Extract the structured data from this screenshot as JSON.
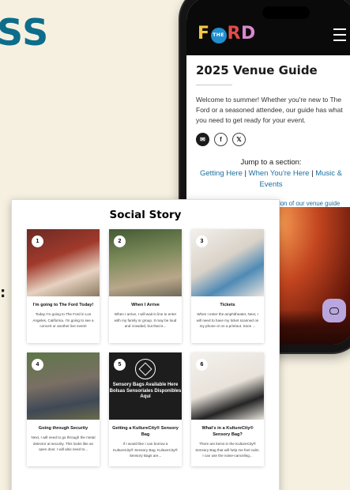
{
  "background": {
    "letters": "SS",
    "colon": ":"
  },
  "phone": {
    "logo": {
      "f": "F",
      "the": "THE",
      "r": "R",
      "d": "D"
    },
    "venue_title": "2025 Venue Guide",
    "welcome": "Welcome to summer! Whether you're new to The Ford or a seasoned attendee, our guide has what you need to get ready for your event.",
    "jump_label": "Jump to a section:",
    "jump_links": [
      "Getting Here",
      "When You're Here",
      "Music & Events"
    ],
    "separator": "|",
    "sensory_link": "View a sensory-friendly version of our venue guide",
    "share_icons": [
      "✉",
      "f",
      "𝕏"
    ]
  },
  "story": {
    "title": "Social Story",
    "tiles": [
      {
        "num": "1",
        "title": "I'm going to The Ford Today!",
        "desc": "Today I'm going to The Ford in Los Angeles, California. I'm going to see a concert or another live event!"
      },
      {
        "num": "2",
        "title": "When I Arrive",
        "desc": "When I arrive, I will wait in line to enter with my family or group. It may be loud and crowded, but that is..."
      },
      {
        "num": "3",
        "title": "Tickets",
        "desc": "When I enter the amphitheater, Next, I will need to have my ticket scanned on my phone or on a printout. Soon ..."
      },
      {
        "num": "4",
        "title": "Going through Security",
        "desc": "Next, I will need to go through the metal detector at security. This looks like an open door. I will also need to..."
      },
      {
        "num": "5",
        "title": "Getting a KultureCity® Sensory Bag",
        "desc": "If I would like I can borrow a KultureCity® Sensory Bag. KultureCity® Sensory Bags are...",
        "image_text": "Sensory Bags Available Here Bolsas Sensoriales Disponibles Aquí"
      },
      {
        "num": "6",
        "title": "What's in a KultureCity® Sensory Bag?",
        "desc": "There are items in the KultureCity® Sensory Bag that will help me feel calm. I can use the noise-canceling..."
      }
    ]
  }
}
